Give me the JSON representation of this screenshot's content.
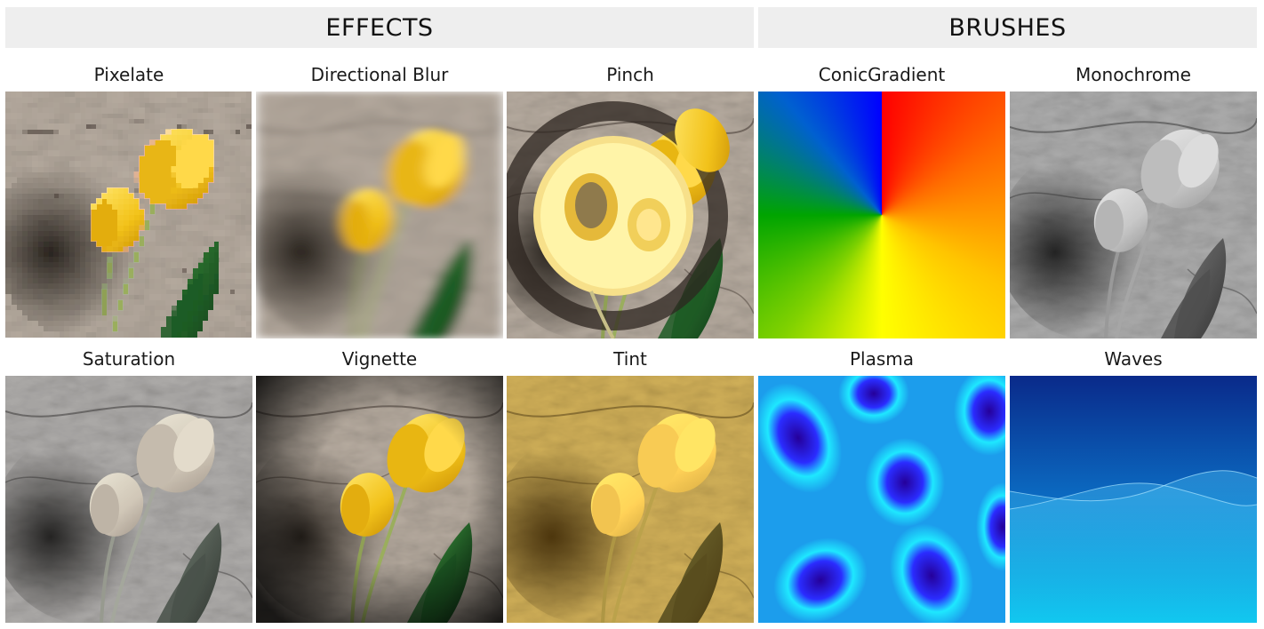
{
  "sections": {
    "effects": "EFFECTS",
    "brushes": "BRUSHES"
  },
  "tiles": [
    {
      "label": "Pixelate",
      "kind": "effect"
    },
    {
      "label": "Directional Blur",
      "kind": "effect"
    },
    {
      "label": "Pinch",
      "kind": "effect"
    },
    {
      "label": "ConicGradient",
      "kind": "brush"
    },
    {
      "label": "Monochrome",
      "kind": "effect"
    },
    {
      "label": "Saturation",
      "kind": "effect"
    },
    {
      "label": "Vignette",
      "kind": "effect"
    },
    {
      "label": "Tint",
      "kind": "effect"
    },
    {
      "label": "Plasma",
      "kind": "brush"
    },
    {
      "label": "Waves",
      "kind": "brush"
    }
  ],
  "colors": {
    "header_bg": "#eeeeee",
    "tulip_yellow": "#f2c21a",
    "tint_orange": "#e88a1c",
    "plasma_cyan": "#1ee8ff",
    "plasma_blue": "#2a2cff",
    "waves_top": "#0a2a8a",
    "waves_bottom": "#12c8f0"
  }
}
